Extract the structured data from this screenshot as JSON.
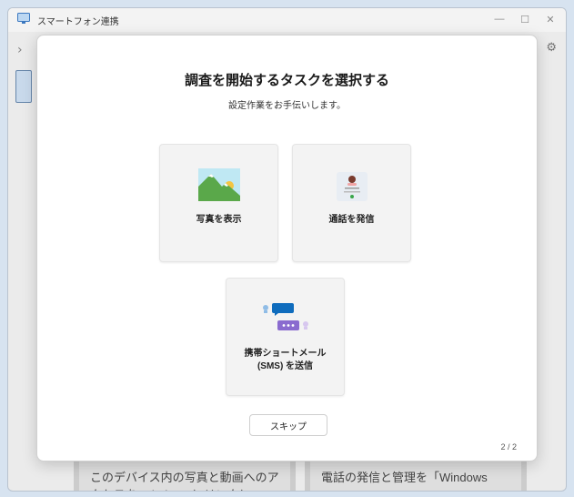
{
  "window": {
    "title": "スマートフォン連携",
    "minimize_glyph": "—",
    "maximize_glyph": "☐",
    "close_glyph": "✕"
  },
  "background": {
    "card1_text": "このデバイス内の写真と動画へのアクセスを Windows にリンクに",
    "card2_text": "電話の発信と管理を「Windows"
  },
  "dialog": {
    "title": "調査を開始するタスクを選択する",
    "subtitle": "設定作業をお手伝いします。",
    "tasks": [
      {
        "label": "写真を表示",
        "icon": "photo-landscape-icon"
      },
      {
        "label": "通話を発信",
        "icon": "phone-call-icon"
      },
      {
        "label_line1": "携帯ショートメール",
        "label_line2": "(SMS) を送信",
        "icon": "chat-bubbles-icon"
      }
    ],
    "skip_label": "スキップ",
    "page_indicator": "2 / 2"
  },
  "colors": {
    "accent": "#0f6cbd",
    "sms_purple": "#8a6bcf",
    "green": "#5aa84a"
  }
}
